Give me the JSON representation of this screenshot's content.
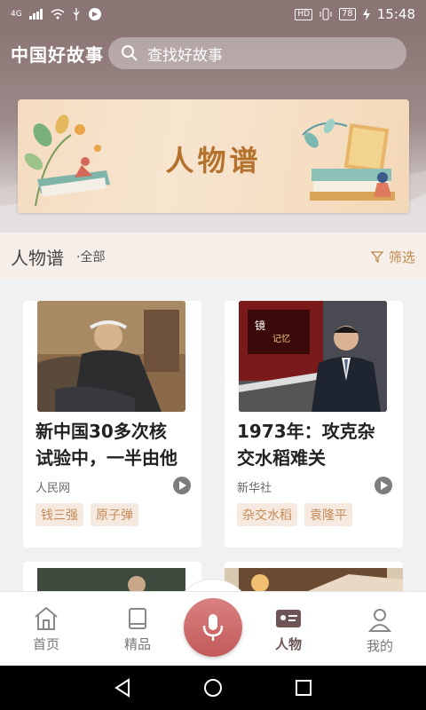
{
  "status_bar": {
    "network": "4G",
    "time": "15:48",
    "battery": "78",
    "hd": "HD"
  },
  "header": {
    "app_title": "中国好故事",
    "search_placeholder": "查找好故事",
    "search_icon": "search-icon"
  },
  "banner": {
    "title": "人物谱"
  },
  "section": {
    "title": "人物谱",
    "filter_all": "·全部",
    "filter_label": "筛选"
  },
  "cards": [
    {
      "title_line1": "新中国30多次核",
      "title_line2": "试验中，一半由他",
      "source": "人民网",
      "tags": [
        "钱三强",
        "原子弹"
      ]
    },
    {
      "title_line1": "1973年：攻克杂",
      "title_line2": "交水稻难关",
      "source": "新华社",
      "tags": [
        "杂交水稻",
        "袁隆平"
      ]
    }
  ],
  "tab_bar": {
    "tabs": [
      {
        "label": "首页",
        "icon": "home-icon"
      },
      {
        "label": "精品",
        "icon": "book-icon"
      },
      {
        "label": "人物",
        "icon": "person-card-icon"
      },
      {
        "label": "我的",
        "icon": "profile-icon"
      }
    ],
    "active": "人物",
    "center_icon": "microphone-icon"
  },
  "colors": {
    "header": "#8b7474",
    "accent": "#c0894b",
    "mic": "#c35a5a"
  }
}
